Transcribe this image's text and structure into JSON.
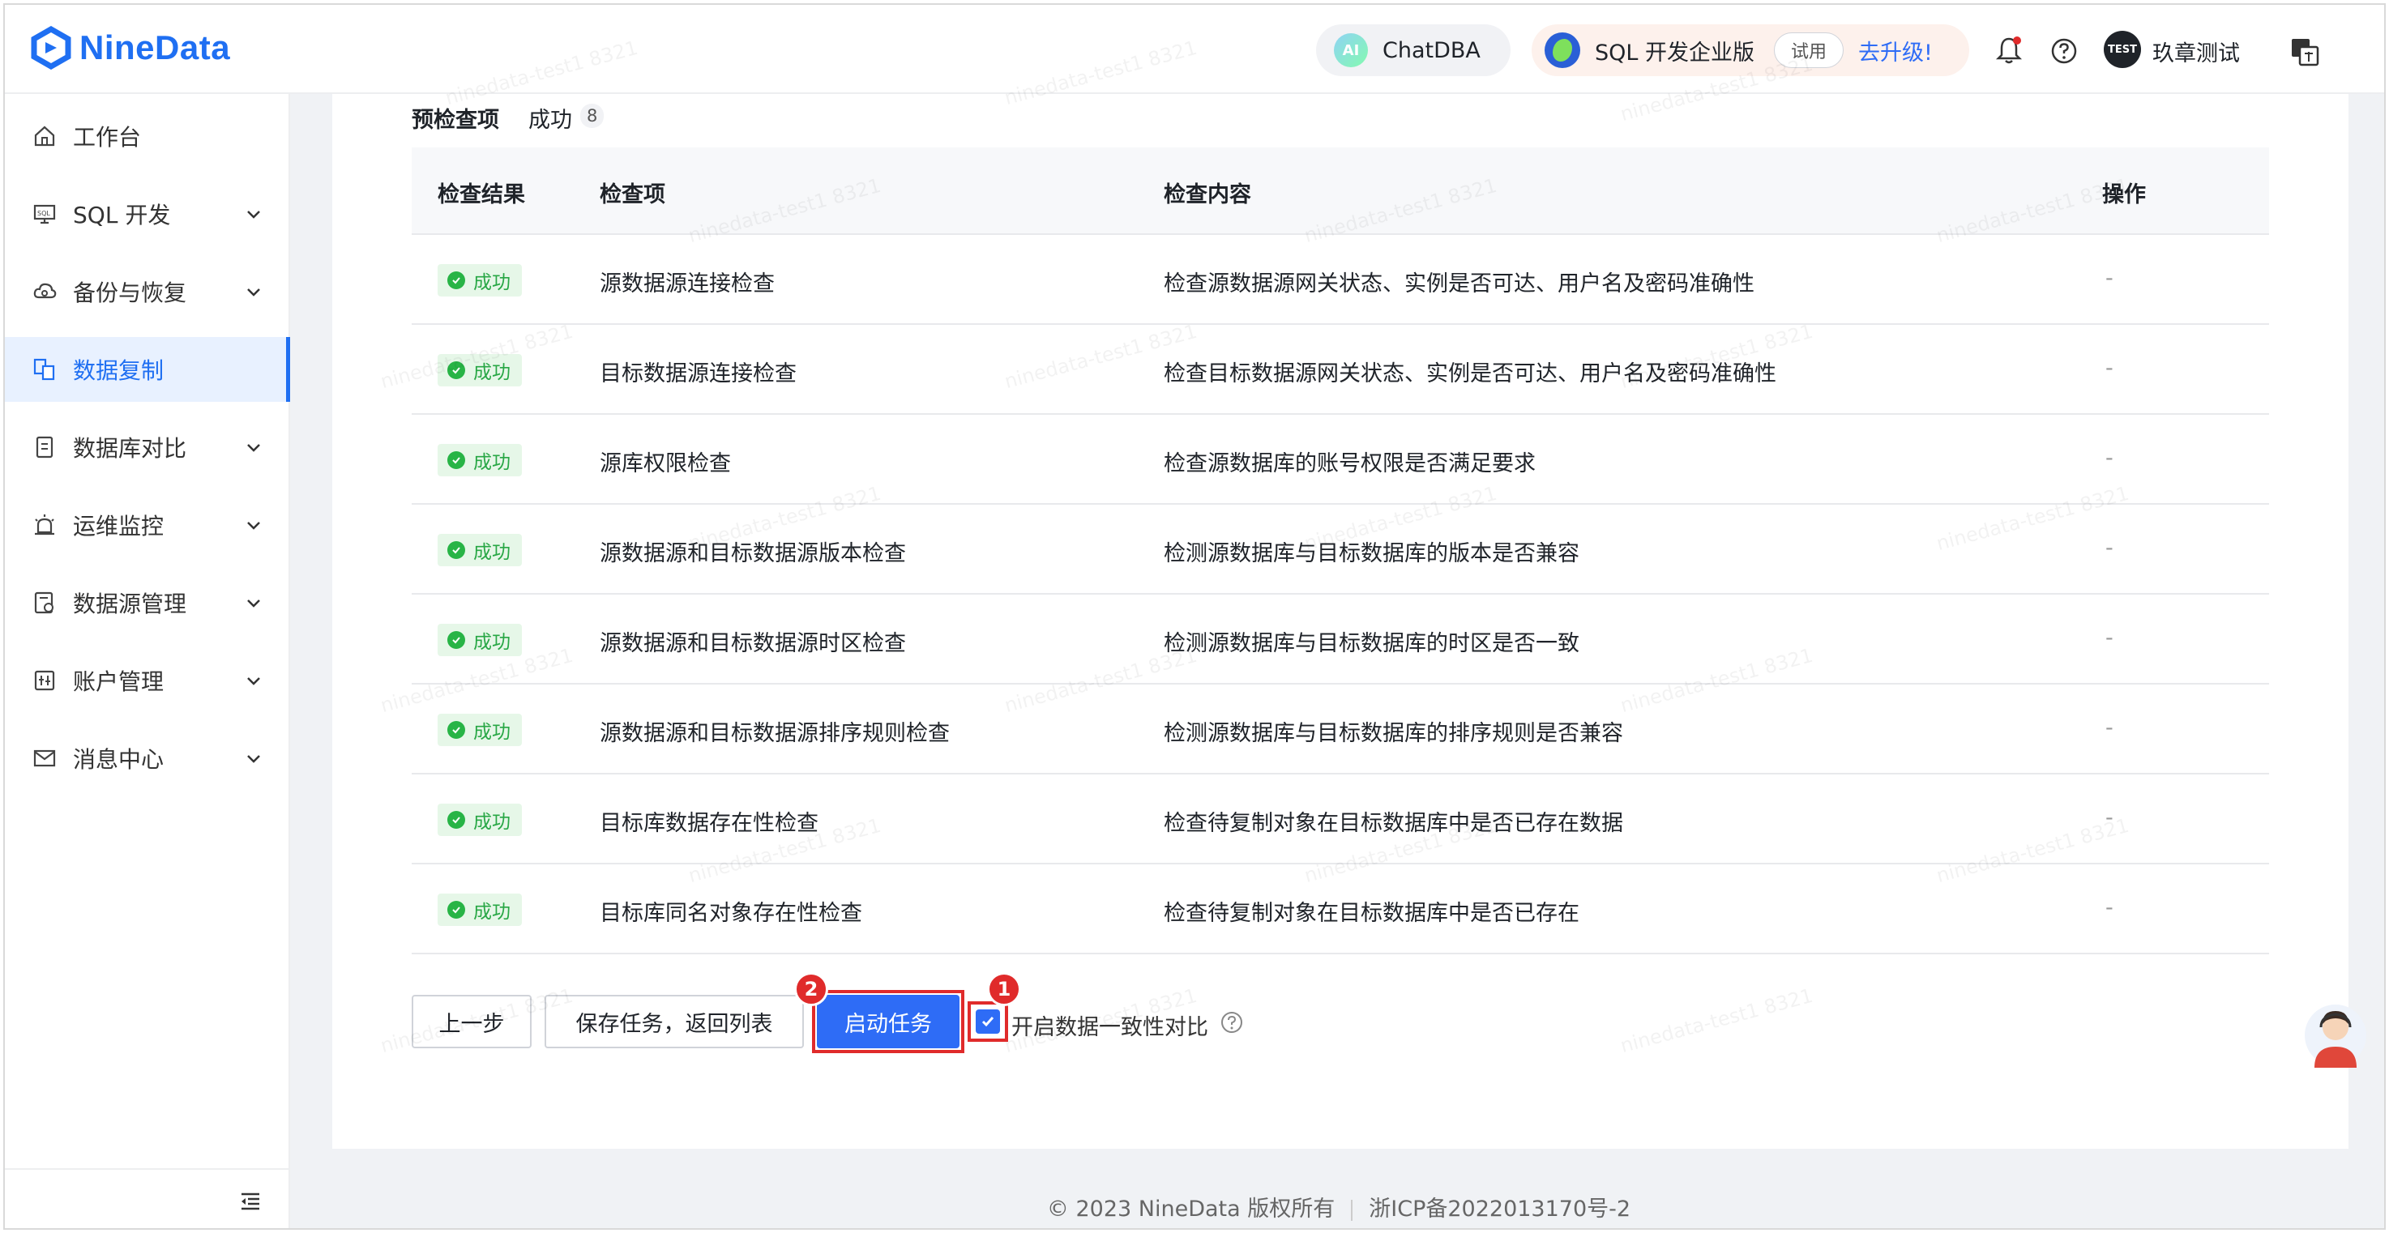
{
  "brand": {
    "name": "NineData",
    "color": "#1f6ff2"
  },
  "header": {
    "chatdba_ai": "AI",
    "chatdba_label": "ChatDBA",
    "sql_edition_label": "SQL 开发企业版",
    "trial_label": "试用",
    "upgrade_label": "去升级!",
    "user_avatar_text": "TEST",
    "user_name": "玖章测试"
  },
  "sidebar": {
    "items": [
      {
        "label": "工作台",
        "icon": "home-icon"
      },
      {
        "label": "SQL 开发",
        "icon": "sql-dev-icon"
      },
      {
        "label": "备份与恢复",
        "icon": "cloud-backup-icon"
      },
      {
        "label": "数据复制",
        "icon": "data-replication-icon"
      },
      {
        "label": "数据库对比",
        "icon": "db-compare-icon"
      },
      {
        "label": "运维监控",
        "icon": "alarm-monitor-icon"
      },
      {
        "label": "数据源管理",
        "icon": "datasource-icon"
      },
      {
        "label": "账户管理",
        "icon": "account-icon"
      },
      {
        "label": "消息中心",
        "icon": "mail-icon"
      }
    ]
  },
  "precheck": {
    "title": "预检查项",
    "status": "成功",
    "count": "8",
    "columns": [
      "检查结果",
      "检查项",
      "检查内容",
      "操作"
    ],
    "rows": [
      {
        "result": "成功",
        "item": "源数据源连接检查",
        "content": "检查源数据源网关状态、实例是否可达、用户名及密码准确性",
        "op": "-"
      },
      {
        "result": "成功",
        "item": "目标数据源连接检查",
        "content": "检查目标数据源网关状态、实例是否可达、用户名及密码准确性",
        "op": "-"
      },
      {
        "result": "成功",
        "item": "源库权限检查",
        "content": "检查源数据库的账号权限是否满足要求",
        "op": "-"
      },
      {
        "result": "成功",
        "item": "源数据源和目标数据源版本检查",
        "content": "检测源数据库与目标数据库的版本是否兼容",
        "op": "-"
      },
      {
        "result": "成功",
        "item": "源数据源和目标数据源时区检查",
        "content": "检测源数据库与目标数据库的时区是否一致",
        "op": "-"
      },
      {
        "result": "成功",
        "item": "源数据源和目标数据源排序规则检查",
        "content": "检测源数据库与目标数据库的排序规则是否兼容",
        "op": "-"
      },
      {
        "result": "成功",
        "item": "目标库数据存在性检查",
        "content": "检查待复制对象在目标数据库中是否已存在数据",
        "op": "-"
      },
      {
        "result": "成功",
        "item": "目标库同名对象存在性检查",
        "content": "检查待复制对象在目标数据库中是否已存在",
        "op": "-"
      }
    ]
  },
  "actions": {
    "prev_label": "上一步",
    "save_label": "保存任务，返回列表",
    "start_label": "启动任务",
    "consistency_label": "开启数据一致性对比",
    "consistency_checked": true,
    "marker_1": "1",
    "marker_2": "2"
  },
  "footer": {
    "copyright": "© 2023 NineData 版权所有",
    "icp": "浙ICP备2022013170号-2"
  },
  "watermark_text": "ninedata-test1 8321"
}
